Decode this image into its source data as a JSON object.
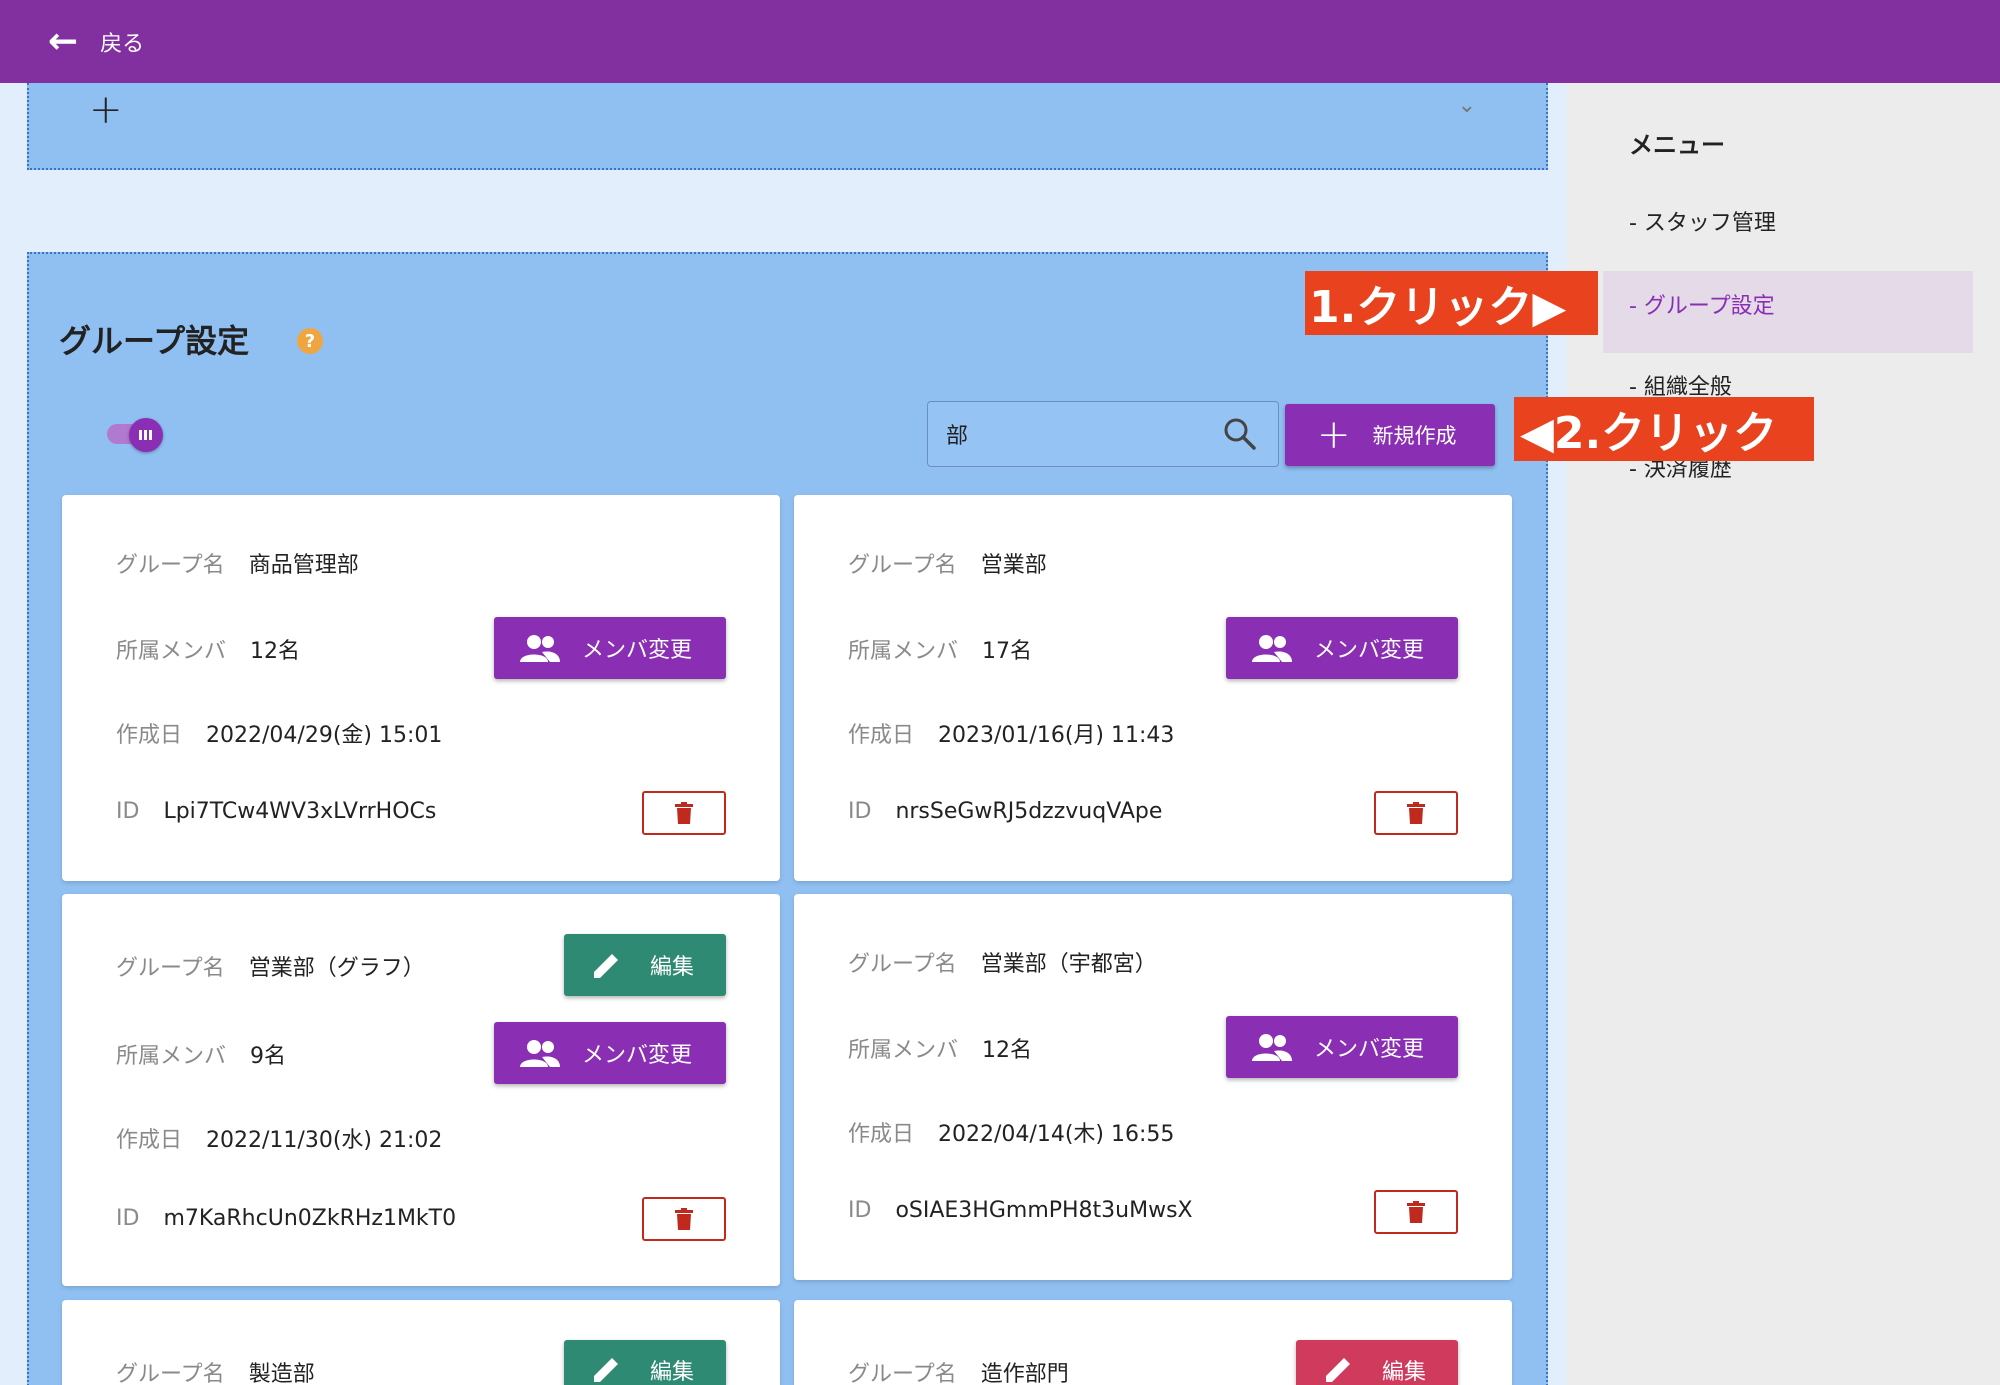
{
  "header": {
    "back_label": "戻る"
  },
  "panel": {
    "title": "グループ設定",
    "help": "?"
  },
  "search": {
    "value": "部"
  },
  "new_button": {
    "label": "新規作成"
  },
  "labels": {
    "group_name": "グループ名",
    "members": "所属メンバ",
    "created": "作成日",
    "id": "ID",
    "member_change": "メンバ変更",
    "edit": "編集"
  },
  "cards": [
    {
      "name": "商品管理部",
      "members": "12名",
      "created": "2022/04/29(金) 15:01",
      "id": "Lpi7TCw4WV3xLVrrHOCs"
    },
    {
      "name": "営業部",
      "members": "17名",
      "created": "2023/01/16(月) 11:43",
      "id": "nrsSeGwRJ5dzzvuqVApe"
    },
    {
      "name": "営業部（グラフ）",
      "members": "9名",
      "created": "2022/11/30(水) 21:02",
      "id": "m7KaRhcUn0ZkRHz1MkT0"
    },
    {
      "name": "営業部（宇都宮）",
      "members": "12名",
      "created": "2022/04/14(木) 16:55",
      "id": "oSIAE3HGmmPH8t3uMwsX"
    },
    {
      "name": "製造部"
    },
    {
      "name": "造作部門"
    }
  ],
  "menu": {
    "title": "メニュー",
    "items": [
      "- スタッフ管理",
      "- グループ設定",
      "- 組織全般",
      "- 決済履歴"
    ],
    "active_index": 1
  },
  "annotations": {
    "step1": "1.クリック▶",
    "step2": "◀2.クリック"
  },
  "colors": {
    "appbar": "#8230a0",
    "primary": "#8a2eb4",
    "edit_green": "#2f8a73",
    "edit_pink": "#d03a5c",
    "delete_red": "#c02a1e",
    "annotation": "#e8421e",
    "panel_blue": "#90c0f2"
  }
}
